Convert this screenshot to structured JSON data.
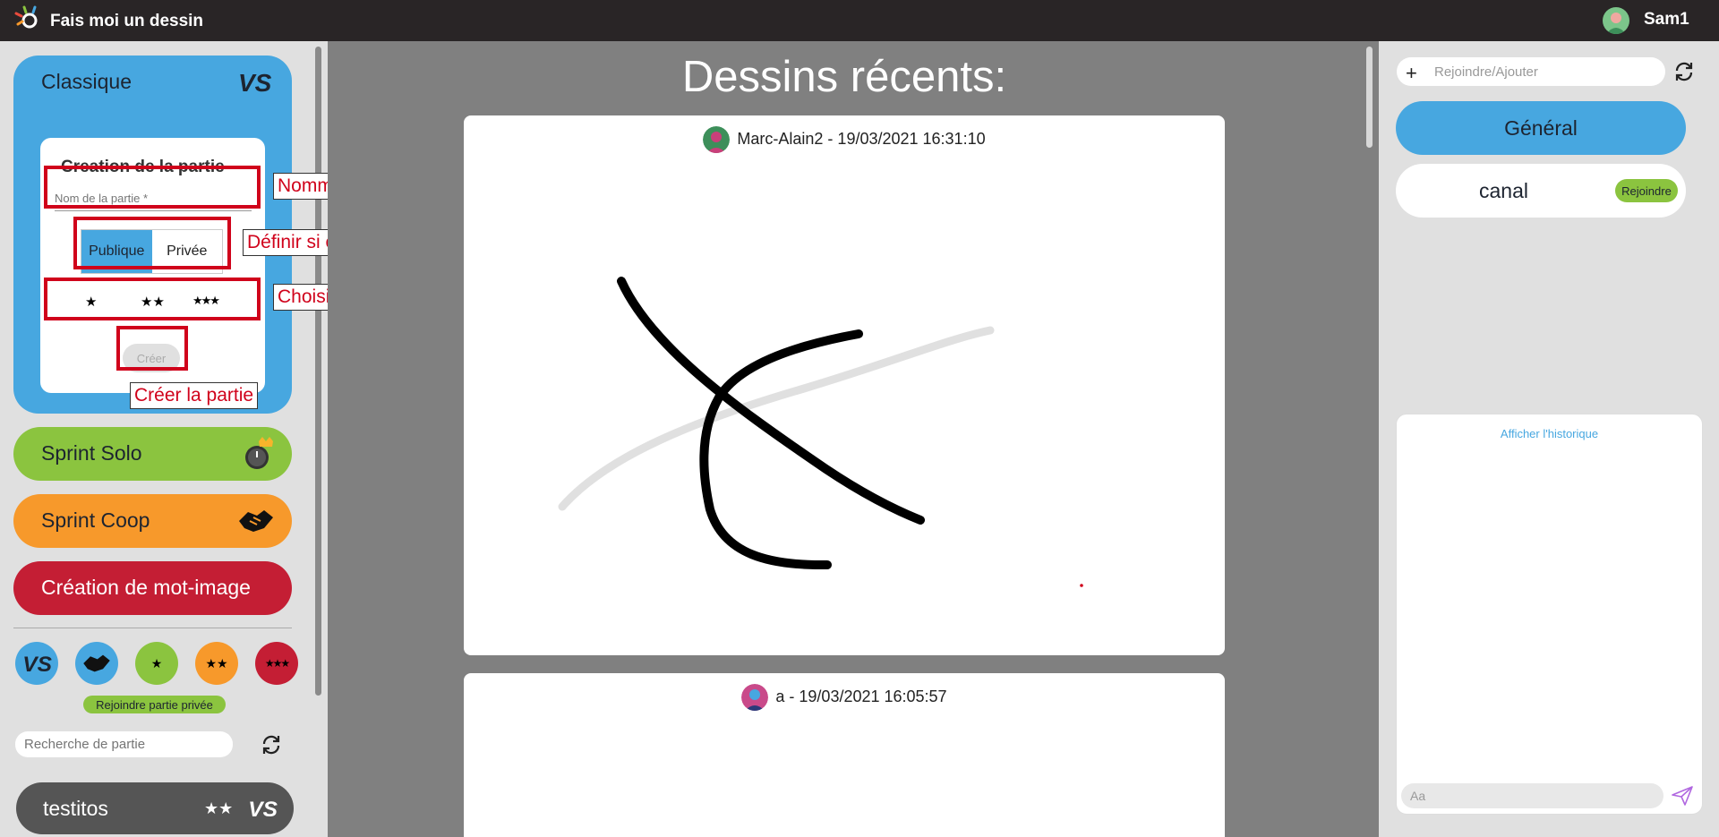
{
  "app": {
    "title": "Fais moi un dessin",
    "user": "Sam1"
  },
  "sidebar": {
    "classique": {
      "title": "Classique",
      "create_panel": {
        "title": "Creation de la partie",
        "name_placeholder": "Nom de la partie *",
        "public_label": "Publique",
        "private_label": "Privée",
        "difficulty": [
          "★",
          "★★",
          "★★★"
        ],
        "create_label": "Créer"
      }
    },
    "modes": {
      "sprint_solo": "Sprint Solo",
      "sprint_coop": "Sprint Coop",
      "mot_image": "Création de mot-image"
    },
    "filters": [
      {
        "icon": "vs-icon",
        "color": "#47a7e0"
      },
      {
        "icon": "handshake-icon",
        "color": "#47a7e0"
      },
      {
        "icon": "one-star",
        "text": "★",
        "color": "#8bc43f"
      },
      {
        "icon": "two-stars",
        "text": "★★",
        "color": "#f7992b"
      },
      {
        "icon": "three-stars",
        "text": "★★★",
        "color": "#c41e34"
      }
    ],
    "join_private": "Rejoindre partie privée",
    "search_placeholder": "Recherche de partie",
    "games": [
      {
        "name": "testitos",
        "stars": "★★"
      }
    ]
  },
  "annotations": {
    "name": "Nommer la partie",
    "privacy": "Définir si c’est une partie privée",
    "difficulty": "Choisir la difficulté",
    "create": "Créer la partie"
  },
  "main": {
    "title": "Dessins récents:",
    "drawings": [
      {
        "author": "Marc-Alain2 - 19/03/2021 16:31:10"
      },
      {
        "author": "a - 19/03/2021 16:05:57"
      }
    ]
  },
  "right": {
    "join_placeholder": "Rejoindre/Ajouter",
    "channels": [
      {
        "name": "Général"
      },
      {
        "name": "canal",
        "action": "Rejoindre"
      }
    ],
    "history_link": "Afficher l'historique",
    "chat_placeholder": "Aa"
  },
  "colors": {
    "blue": "#47a7e0",
    "green": "#8bc43f",
    "orange": "#f7992b",
    "red": "#c41e34",
    "topbar": "#292526"
  }
}
